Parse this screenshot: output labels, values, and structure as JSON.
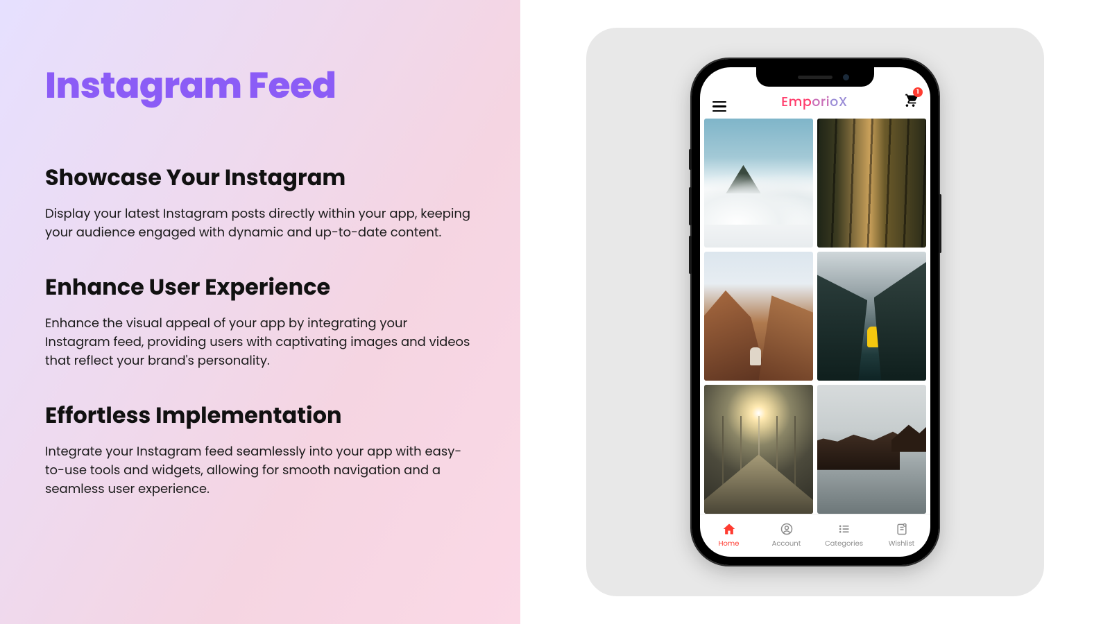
{
  "page_title": "Instagram Feed",
  "sections": [
    {
      "heading": "Showcase Your Instagram",
      "body": "Display your latest Instagram posts directly within your app, keeping your audience engaged with dynamic and up-to-date content."
    },
    {
      "heading": "Enhance User Experience",
      "body": "Enhance the visual appeal of your app by integrating your Instagram feed, providing users with captivating images and videos that reflect your brand's personality."
    },
    {
      "heading": "Effortless Implementation",
      "body": "Integrate your Instagram feed seamlessly into your app with easy-to-use tools and widgets, allowing for smooth navigation and a seamless user experience."
    }
  ],
  "phone": {
    "brand": {
      "part1": "Emp",
      "part2": "ori",
      "part3": "oX"
    },
    "cart_badge": "1",
    "nav": [
      {
        "label": "Home",
        "active": true
      },
      {
        "label": "Account",
        "active": false
      },
      {
        "label": "Categories",
        "active": false
      },
      {
        "label": "Wishlist",
        "active": false
      }
    ]
  }
}
